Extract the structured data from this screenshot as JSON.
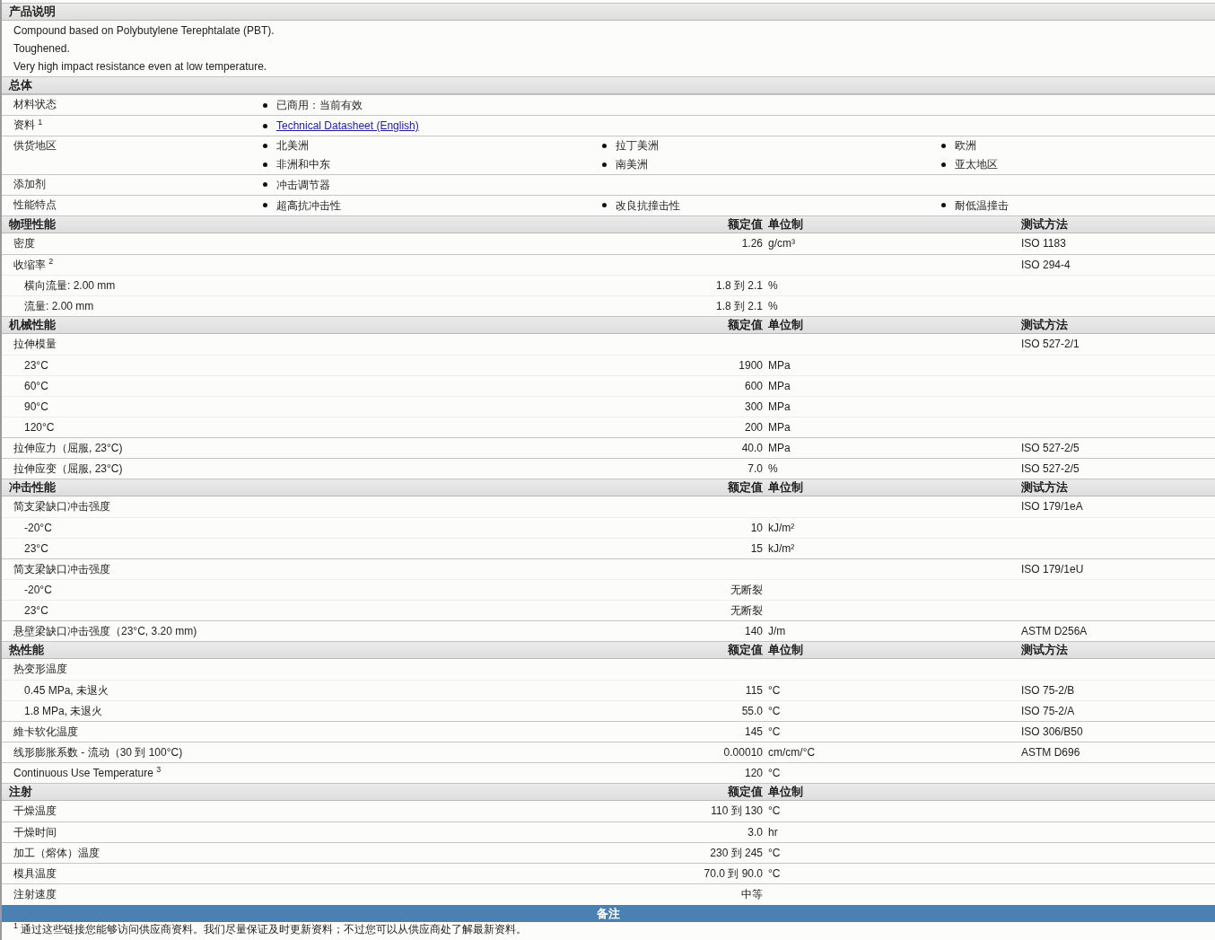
{
  "description": {
    "title": "产品说明",
    "lines": [
      "Compound based on Polybutylene Terephtalate (PBT).",
      "Toughened.",
      "Very high impact resistance even at low temperature."
    ]
  },
  "general": {
    "title": "总体",
    "rows": [
      {
        "label": "材料状态",
        "items": [
          {
            "kind": "text",
            "text": "已商用：当前有效"
          }
        ]
      },
      {
        "label": "资料 $^{1}$",
        "items": [
          {
            "kind": "link",
            "text": "Technical Datasheet (English)"
          }
        ]
      },
      {
        "label": "供货地区",
        "items": [
          {
            "kind": "text",
            "text": "北美洲"
          },
          {
            "kind": "text",
            "text": "拉丁美洲"
          },
          {
            "kind": "text",
            "text": "欧洲"
          },
          {
            "kind": "text",
            "text": "非洲和中东"
          },
          {
            "kind": "text",
            "text": "南美洲"
          },
          {
            "kind": "text",
            "text": "亚太地区"
          }
        ]
      },
      {
        "label": "添加剂",
        "items": [
          {
            "kind": "text",
            "text": "冲击调节器"
          }
        ]
      },
      {
        "label": "性能特点",
        "items": [
          {
            "kind": "text",
            "text": "超高抗冲击性"
          },
          {
            "kind": "text",
            "text": "改良抗撞击性"
          },
          {
            "kind": "text",
            "text": "耐低温撞击"
          }
        ]
      }
    ]
  },
  "sections": [
    {
      "title": "物理性能",
      "columns": [
        "额定值",
        "单位制",
        "测试方法"
      ],
      "rows": [
        {
          "label": "密度",
          "value": "1.26",
          "unit": "g/cm³",
          "method": "ISO 1183"
        },
        {
          "label": "收缩率 $^{2}$",
          "method": "ISO 294-4",
          "children": [
            {
              "label": "横向流量: 2.00 mm",
              "value": "1.8 到  2.1",
              "unit": "%"
            },
            {
              "label": "流量: 2.00 mm",
              "value": "1.8 到  2.1",
              "unit": "%"
            }
          ]
        }
      ]
    },
    {
      "title": "机械性能",
      "columns": [
        "额定值",
        "单位制",
        "测试方法"
      ],
      "rows": [
        {
          "label": "拉伸模量",
          "method": "ISO 527-2/1",
          "children": [
            {
              "label": "23°C",
              "value": "1900",
              "unit": "MPa"
            },
            {
              "label": "60°C",
              "value": "600",
              "unit": "MPa"
            },
            {
              "label": "90°C",
              "value": "300",
              "unit": "MPa"
            },
            {
              "label": "120°C",
              "value": "200",
              "unit": "MPa"
            }
          ]
        },
        {
          "label": "拉伸应力（屈服, 23°C)",
          "value": "40.0",
          "unit": "MPa",
          "method": "ISO 527-2/5"
        },
        {
          "label": "拉伸应变（屈服, 23°C)",
          "value": "7.0",
          "unit": "%",
          "method": "ISO 527-2/5"
        }
      ]
    },
    {
      "title": "冲击性能",
      "columns": [
        "额定值",
        "单位制",
        "测试方法"
      ],
      "rows": [
        {
          "label": "简支梁缺口冲击强度",
          "method": "ISO 179/1eA",
          "children": [
            {
              "label": "-20°C",
              "value": "10",
              "unit": "kJ/m²"
            },
            {
              "label": "23°C",
              "value": "15",
              "unit": "kJ/m²"
            }
          ]
        },
        {
          "label": "简支梁缺口冲击强度",
          "method": "ISO 179/1eU",
          "children": [
            {
              "label": "-20°C",
              "value": "无断裂"
            },
            {
              "label": "23°C",
              "value": "无断裂"
            }
          ]
        },
        {
          "label": "悬壁梁缺口冲击强度（23°C, 3.20 mm)",
          "value": "140",
          "unit": "J/m",
          "method": "ASTM D256A"
        }
      ]
    },
    {
      "title": "热性能",
      "columns": [
        "额定值",
        "单位制",
        "测试方法"
      ],
      "rows": [
        {
          "label": "热变形温度",
          "children": [
            {
              "label": "0.45 MPa, 未退火",
              "value": "115",
              "unit": "°C",
              "method": "ISO 75-2/B"
            },
            {
              "label": "1.8 MPa, 未退火",
              "value": "55.0",
              "unit": "°C",
              "method": "ISO 75-2/A"
            }
          ]
        },
        {
          "label": "維卡软化温度",
          "value": "145",
          "unit": "°C",
          "method": "ISO 306/B50"
        },
        {
          "label": "线形膨胀系数 - 流动（30 到  100°C)",
          "value": "0.00010",
          "unit": "cm/cm/°C",
          "method": "ASTM D696"
        },
        {
          "label": "Continuous Use Temperature $^{3}$",
          "value": "120",
          "unit": "°C"
        }
      ]
    },
    {
      "title": "注射",
      "columns": [
        "额定值",
        "单位制"
      ],
      "rows": [
        {
          "label": "干燥温度",
          "value": "110 到  130",
          "unit": "°C"
        },
        {
          "label": "干燥时间",
          "value": "3.0",
          "unit": "hr"
        },
        {
          "label": "加工（熔体）温度",
          "value": "230 到  245",
          "unit": "°C"
        },
        {
          "label": "模具温度",
          "value": "70.0 到  90.0",
          "unit": "°C"
        },
        {
          "label": "注射速度",
          "value": "中等"
        }
      ]
    }
  ],
  "notes": {
    "title": "备注",
    "footnotes": [
      "$^{1}$ 通过这些链接您能够访问供应商资料。我们尽量保证及时更新资料；不过您可以从供应商处了解最新资料。"
    ]
  }
}
